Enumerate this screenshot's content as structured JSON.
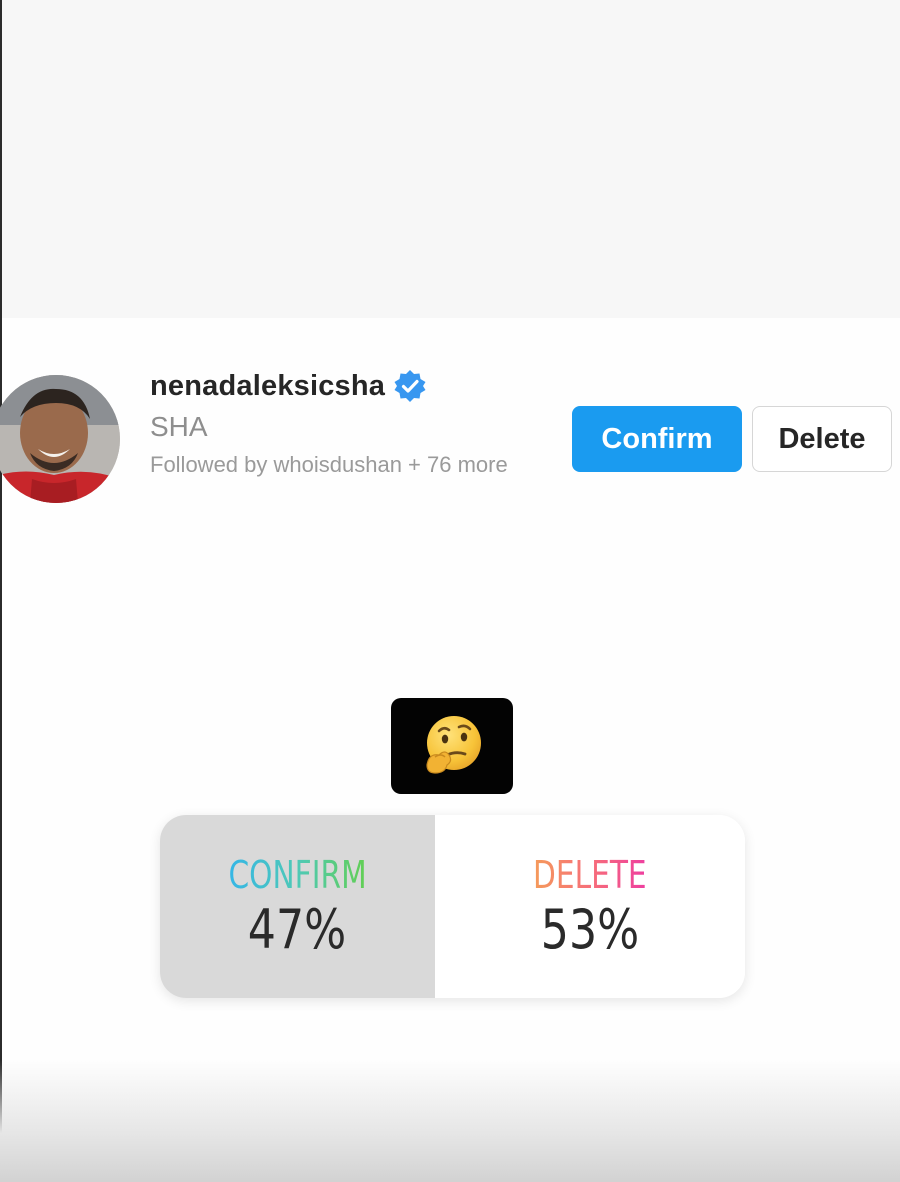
{
  "request": {
    "username": "nenadaleksicsha",
    "full_name": "SHA",
    "followed_by": "Followed by whoisdushan + 76 more",
    "confirm_label": "Confirm",
    "delete_label": "Delete",
    "verified_icon": "verified-badge-icon",
    "accent_color": "#1a9bf0"
  },
  "story": {
    "emoji_sticker": "🤔",
    "emoji_icon": "thinking-face-icon",
    "poll": {
      "options": [
        {
          "label": "CONFIRM",
          "percent": "47%",
          "fraction": 0.47
        },
        {
          "label": "DELETE",
          "percent": "53%",
          "fraction": 0.53
        }
      ]
    }
  }
}
